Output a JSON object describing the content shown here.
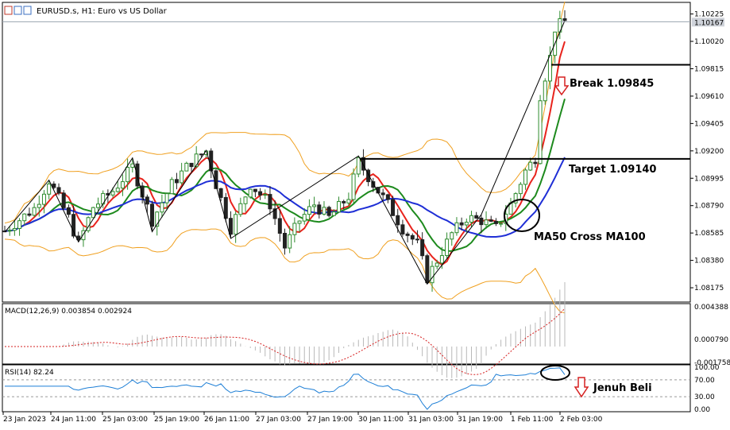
{
  "header": {
    "symbol": "EURUSD.s, H1:  Euro vs US Dollar"
  },
  "price_panel": {
    "y_ticks": [
      "1.10225",
      "1.10020",
      "1.09815",
      "1.09610",
      "1.09405",
      "1.09200",
      "1.08995",
      "1.08790",
      "1.08585",
      "1.08380",
      "1.08175"
    ],
    "current_price": "1.10167",
    "colors": {
      "bull": "#2e8b2e",
      "bear": "#222222",
      "bands": "#f0a020",
      "ma_red": "#e8231c",
      "ma_green": "#1d8a1d",
      "ma_blue": "#1f2fd6",
      "zigzag": "#000000",
      "current_price_tag": "#cfd3da"
    }
  },
  "annotations": {
    "break": "Break 1.09845",
    "target": "Target 1.09140",
    "cross": "MA50 Cross MA100",
    "jenuh": "Jenuh Beli"
  },
  "macd_panel": {
    "label": "MACD(12,26,9) 0.003854 0.002924",
    "y_ticks": [
      "0.004388",
      "0.000790",
      "-0.001758"
    ]
  },
  "rsi_panel": {
    "label": "RSI(14) 82.24",
    "y_ticks": [
      "100.00",
      "70.00",
      "30.00",
      "0.00"
    ],
    "levels": [
      70,
      30
    ]
  },
  "x_axis": {
    "labels": [
      "23 Jan 2023",
      "24 Jan 11:00",
      "25 Jan 03:00",
      "25 Jan 19:00",
      "26 Jan 11:00",
      "27 Jan 03:00",
      "27 Jan 19:00",
      "30 Jan 11:00",
      "31 Jan 03:00",
      "31 Jan 19:00",
      "1 Feb 11:00",
      "2 Feb 03:00"
    ]
  },
  "chart_data": {
    "type": "candlestick",
    "symbol": "EURUSD.s",
    "timeframe": "H1",
    "y_range": [
      1.0808,
      1.103
    ],
    "levels": {
      "break": 1.09845,
      "target": 1.0914,
      "current": 1.10167
    },
    "close_path": [
      {
        "x": 0,
        "close": 1.086
      },
      {
        "x": 6,
        "close": 1.0877
      },
      {
        "x": 9,
        "close": 1.0898
      },
      {
        "x": 13,
        "close": 1.087
      },
      {
        "x": 15,
        "close": 1.085
      },
      {
        "x": 18,
        "close": 1.0878
      },
      {
        "x": 22,
        "close": 1.089
      },
      {
        "x": 26,
        "close": 1.0908
      },
      {
        "x": 30,
        "close": 1.0868
      },
      {
        "x": 34,
        "close": 1.0895
      },
      {
        "x": 38,
        "close": 1.0912
      },
      {
        "x": 41,
        "close": 1.092
      },
      {
        "x": 43,
        "close": 1.0895
      },
      {
        "x": 46,
        "close": 1.0862
      },
      {
        "x": 50,
        "close": 1.0895
      },
      {
        "x": 54,
        "close": 1.088
      },
      {
        "x": 57,
        "close": 1.0848
      },
      {
        "x": 60,
        "close": 1.0868
      },
      {
        "x": 63,
        "close": 1.088
      },
      {
        "x": 66,
        "close": 1.087
      },
      {
        "x": 70,
        "close": 1.0886
      },
      {
        "x": 72,
        "close": 1.0912
      },
      {
        "x": 75,
        "close": 1.0895
      },
      {
        "x": 78,
        "close": 1.088
      },
      {
        "x": 81,
        "close": 1.0862
      },
      {
        "x": 84,
        "close": 1.085
      },
      {
        "x": 86,
        "close": 1.0825
      },
      {
        "x": 88,
        "close": 1.0838
      },
      {
        "x": 91,
        "close": 1.0858
      },
      {
        "x": 94,
        "close": 1.087
      },
      {
        "x": 97,
        "close": 1.0868
      },
      {
        "x": 100,
        "close": 1.0862
      },
      {
        "x": 103,
        "close": 1.088
      },
      {
        "x": 106,
        "close": 1.0905
      },
      {
        "x": 108,
        "close": 1.0915
      },
      {
        "x": 109,
        "close": 1.0962
      },
      {
        "x": 111,
        "close": 1.099
      },
      {
        "x": 112,
        "close": 1.1012
      },
      {
        "x": 114,
        "close": 1.1017
      }
    ],
    "indicators": [
      "Bollinger Bands",
      "MA (red)",
      "MA50 (green)",
      "MA100 (blue)",
      "ZigZag"
    ],
    "macd": {
      "macd": 0.003854,
      "signal": 0.002924,
      "y_range": [
        -0.001758,
        0.004388
      ]
    },
    "rsi": {
      "value": 82.24,
      "y_range": [
        0,
        100
      ],
      "levels": [
        70,
        30
      ]
    }
  }
}
